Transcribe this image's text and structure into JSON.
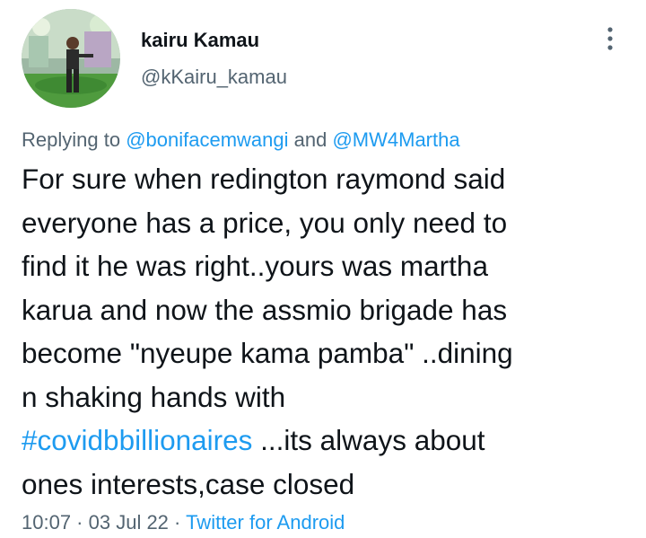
{
  "author": {
    "display_name": "kairu Kamau",
    "handle": "@kKairu_kamau",
    "avatar": "profile-photo"
  },
  "reply": {
    "prefix": "Replying to ",
    "user1": "@bonifacemwangi",
    "joiner": " and ",
    "user2": "@MW4Martha"
  },
  "tweet": {
    "lines": [
      "For sure when redington raymond said",
      "everyone has a price, you only need to",
      "find it he was right..yours was martha",
      "karua and now the assmio brigade has",
      "become \"nyeupe kama pamba\" ..dining",
      "n shaking hands with"
    ],
    "hashtag": "#covidbbillionaires",
    "after_hashtag": " ...its always about",
    "last_line": "ones interests,case closed"
  },
  "meta": {
    "time": "10:07",
    "sep1": " · ",
    "date": "03 Jul 22",
    "sep2": " · ",
    "source": "Twitter for Android"
  },
  "icons": {
    "more": "more-vertical-icon"
  },
  "colors": {
    "link": "#1d9bf0",
    "secondary_text": "#536471",
    "primary_text": "#0f1419"
  }
}
